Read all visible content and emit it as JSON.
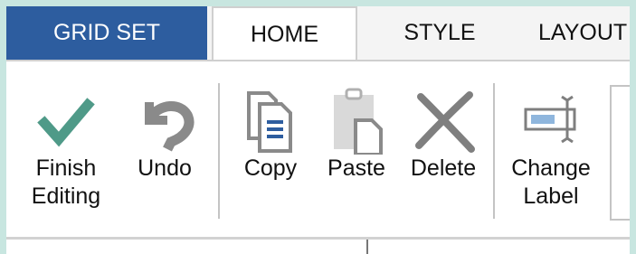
{
  "tabs": [
    {
      "label": "GRID SET"
    },
    {
      "label": "HOME"
    },
    {
      "label": "STYLE"
    },
    {
      "label": "LAYOUT"
    }
  ],
  "ribbon": {
    "finish_editing": "Finish\nEditing",
    "undo": "Undo",
    "copy": "Copy",
    "paste": "Paste",
    "delete": "Delete",
    "change_label": "Change\nLabel"
  },
  "colors": {
    "accent": "#2d5d9f",
    "check": "#4f9a88",
    "gray_icon": "#8a8a8a",
    "background": "#c8e6e0"
  }
}
